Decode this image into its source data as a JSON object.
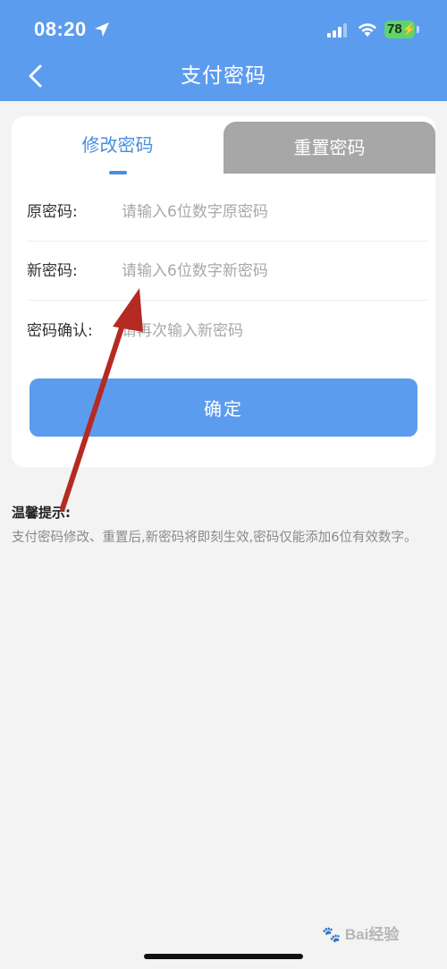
{
  "status_bar": {
    "time": "08:20",
    "battery": "78"
  },
  "header": {
    "title": "支付密码"
  },
  "tabs": [
    {
      "label": "修改密码",
      "active": true
    },
    {
      "label": "重置密码",
      "active": false
    }
  ],
  "form": {
    "fields": [
      {
        "label": "原密码:",
        "placeholder": "请输入6位数字原密码",
        "value": ""
      },
      {
        "label": "新密码:",
        "placeholder": "请输入6位数字新密码",
        "value": ""
      },
      {
        "label": "密码确认:",
        "placeholder": "请再次输入新密码",
        "value": ""
      }
    ],
    "confirm_label": "确定"
  },
  "tips": {
    "title": "温馨提示:",
    "text": "支付密码修改、重置后,新密码将即刻生效,密码仅能添加6位有效数字。"
  },
  "watermark": {
    "text": "Bai经验"
  },
  "colors": {
    "primary": "#5c9cee",
    "tab_active_text": "#4a8ee0",
    "tab_inactive_bg": "#a7a7a7",
    "annotation_arrow": "#b52a22",
    "battery": "#5fd46a"
  },
  "icons": {
    "back": "chevron-left-icon",
    "location": "location-arrow-icon",
    "signal": "cellular-signal-icon",
    "wifi": "wifi-icon",
    "battery": "battery-charging-icon"
  }
}
